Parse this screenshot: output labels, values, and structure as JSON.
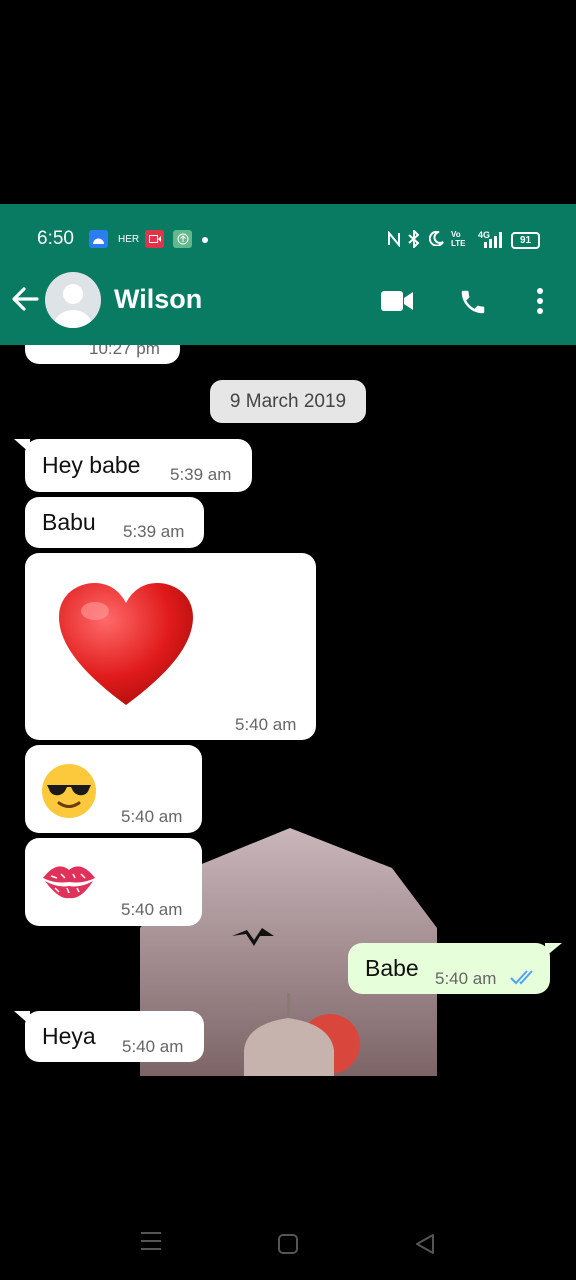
{
  "status_bar": {
    "time": "6:50",
    "notif_text": "HER",
    "network": "4G",
    "volte": "Vo LTE",
    "battery": "91"
  },
  "header": {
    "contact_name": "Wilson",
    "back_icon": "back-arrow-icon",
    "avatar_icon": "default-avatar-icon",
    "video_call_icon": "video-camera-icon",
    "voice_call_icon": "phone-icon",
    "menu_icon": "more-vertical-icon",
    "color": "#097b62"
  },
  "chat": {
    "partial_time": "10:27 pm",
    "date_label": "9 March 2019",
    "messages": [
      {
        "direction": "in",
        "text": "Hey babe",
        "time": "5:39 am"
      },
      {
        "direction": "in",
        "text": "Babu",
        "time": "5:39 am"
      },
      {
        "direction": "in",
        "emoji": "heart",
        "time": "5:40 am"
      },
      {
        "direction": "in",
        "emoji": "sunglasses-face",
        "time": "5:40 am"
      },
      {
        "direction": "in",
        "emoji": "kiss-mark",
        "time": "5:40 am"
      },
      {
        "direction": "out",
        "text": "Babe",
        "time": "5:40 am",
        "ticks": "double-tick-read-icon"
      },
      {
        "direction": "in",
        "text": "Heya",
        "time": "5:40 am"
      }
    ]
  },
  "colors": {
    "incoming_bubble": "#ffffff",
    "outgoing_bubble": "#e7fedb",
    "read_tick": "#4fa3f7",
    "background": "#000000"
  },
  "nav_bar": {
    "recents_icon": "menu-lines-icon",
    "home_icon": "square-home-icon",
    "back_icon": "triangle-back-icon"
  }
}
